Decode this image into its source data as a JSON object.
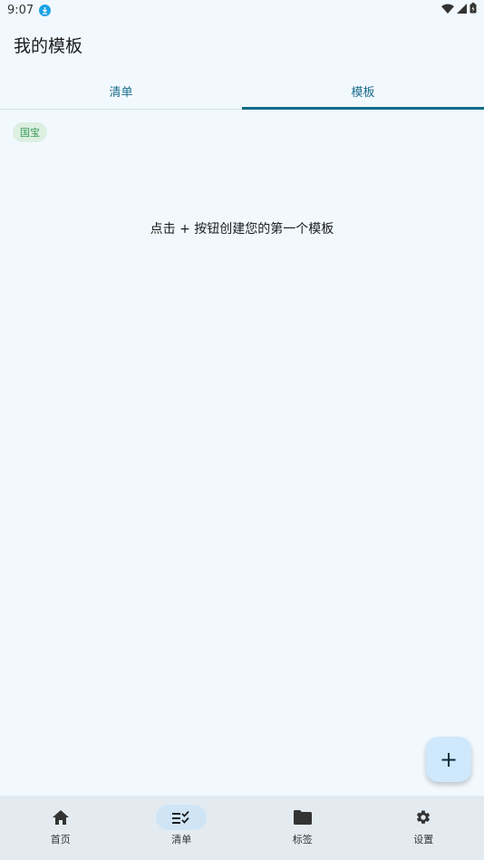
{
  "status_bar": {
    "time": "9:07"
  },
  "app_bar": {
    "title": "我的模板"
  },
  "tabs": [
    {
      "label": "清单",
      "active": false
    },
    {
      "label": "模板",
      "active": true
    }
  ],
  "filter_chip": {
    "label": "国宝"
  },
  "empty_state": {
    "message": "点击 + 按钮创建您的第一个模板"
  },
  "fab": {
    "label": "+"
  },
  "bottom_nav": {
    "items": [
      {
        "label": "首页",
        "icon": "home-icon",
        "active": false
      },
      {
        "label": "清单",
        "icon": "checklist-icon",
        "active": true
      },
      {
        "label": "标签",
        "icon": "folder-icon",
        "active": false
      },
      {
        "label": "设置",
        "icon": "gear-icon",
        "active": false
      }
    ]
  },
  "colors": {
    "background": "#f2f9fe",
    "accent": "#0e6b87",
    "chip_bg": "#dcefe0",
    "chip_text": "#3a9b57",
    "fab_bg": "#cfe8fb",
    "nav_bg": "#e3ebf1"
  }
}
